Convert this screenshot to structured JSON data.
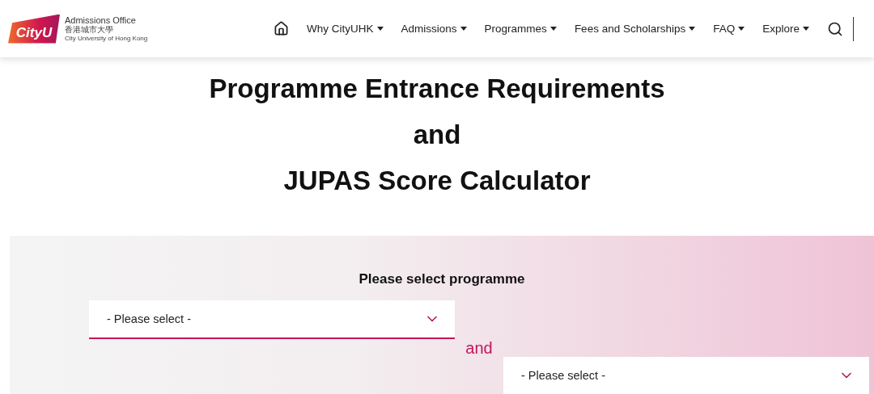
{
  "header": {
    "logo": {
      "wordmark": "CityU",
      "office": "Admissions Office",
      "chinese_name": "香港城市大學",
      "english_name": "City University of Hong Kong"
    },
    "nav": [
      {
        "label": "Why CityUHK"
      },
      {
        "label": "Admissions"
      },
      {
        "label": "Programmes"
      },
      {
        "label": "Fees and Scholarships"
      },
      {
        "label": "FAQ"
      },
      {
        "label": "Explore"
      }
    ]
  },
  "title_lines": [
    "Programme Entrance Requirements",
    "and",
    "JUPAS Score Calculator"
  ],
  "selector": {
    "heading": "Please select programme",
    "first": {
      "value": "- Please select -"
    },
    "joiner": "and",
    "second": {
      "value": "- Please select -"
    }
  }
}
